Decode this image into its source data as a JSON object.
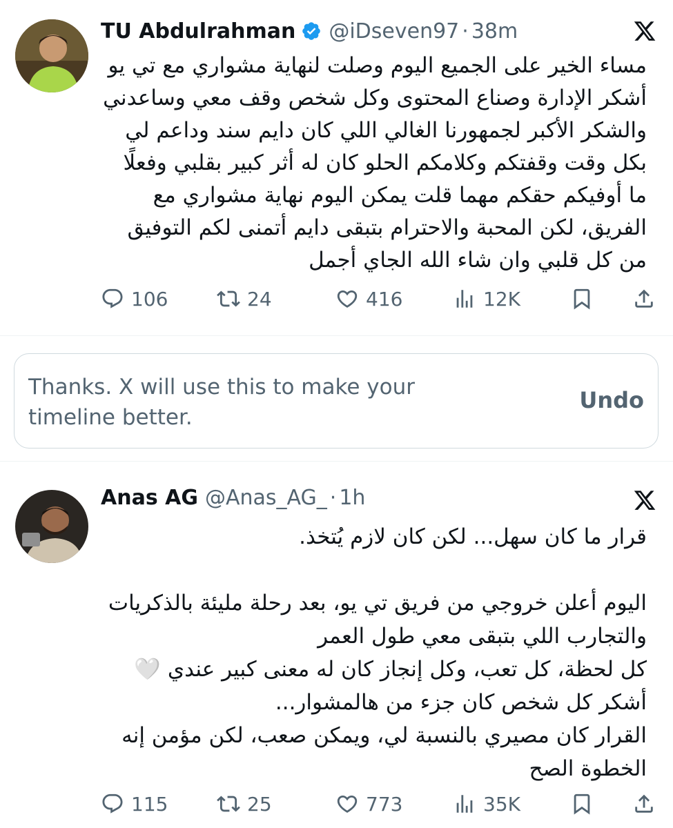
{
  "tweets": [
    {
      "author_name": "TU Abdulrahman",
      "handle": "@iDseven97",
      "separator": "·",
      "time": "38m",
      "verified": true,
      "text": "مساء الخير على الجميع اليوم وصلت لنهاية مشواري مع تي يو أشكر الإدارة وصناع المحتوى وكل شخص وقف معي وساعدني والشكر الأكبر لجمهورنا الغالي اللي كان دايم سند وداعم لي بكل وقت وقفتكم وكلامكم الحلو كان له أثر كبير بقلبي وفعلًا ما أوفيكم حقكم مهما قلت يمكن اليوم نهاية مشواري مع الفريق، لكن المحبة والاحترام بتبقى دايم أتمنى لكم التوفيق من كل قلبي وان شاء الله الجاي أجمل",
      "replies": "106",
      "retweets": "24",
      "likes": "416",
      "views": "12K"
    },
    {
      "author_name": "Anas AG",
      "handle": "@Anas_AG_",
      "separator": "·",
      "time": "1h",
      "verified": false,
      "text": "قرار ما كان سهل... لكن كان لازم يُتخذ.\n\nاليوم أعلن خروجي من فريق تي يو، بعد رحلة مليئة بالذكريات والتجارب اللي بتبقى معي طول العمر\nكل لحظة، كل تعب، وكل إنجاز كان له معنى كبير عندي 🤍\nأشكر كل شخص كان جزء من هالمشوار...\nالقرار كان مصيري بالنسبة لي، ويمكن صعب، لكن مؤمن إنه الخطوة الصح",
      "replies": "115",
      "retweets": "25",
      "likes": "773",
      "views": "35K"
    }
  ],
  "feedback": {
    "message": "Thanks. X will use this to make your timeline better.",
    "undo_label": "Undo"
  },
  "icons": {
    "reply": "reply-icon",
    "retweet": "retweet-icon",
    "like": "heart-icon",
    "views": "views-icon",
    "bookmark": "bookmark-icon",
    "share": "share-icon",
    "platform": "x-logo-icon",
    "verified": "verified-badge-icon"
  },
  "colors": {
    "text_primary": "#0f1419",
    "text_secondary": "#536471",
    "verified_blue": "#1d9bf0",
    "border": "#cfd9de"
  }
}
